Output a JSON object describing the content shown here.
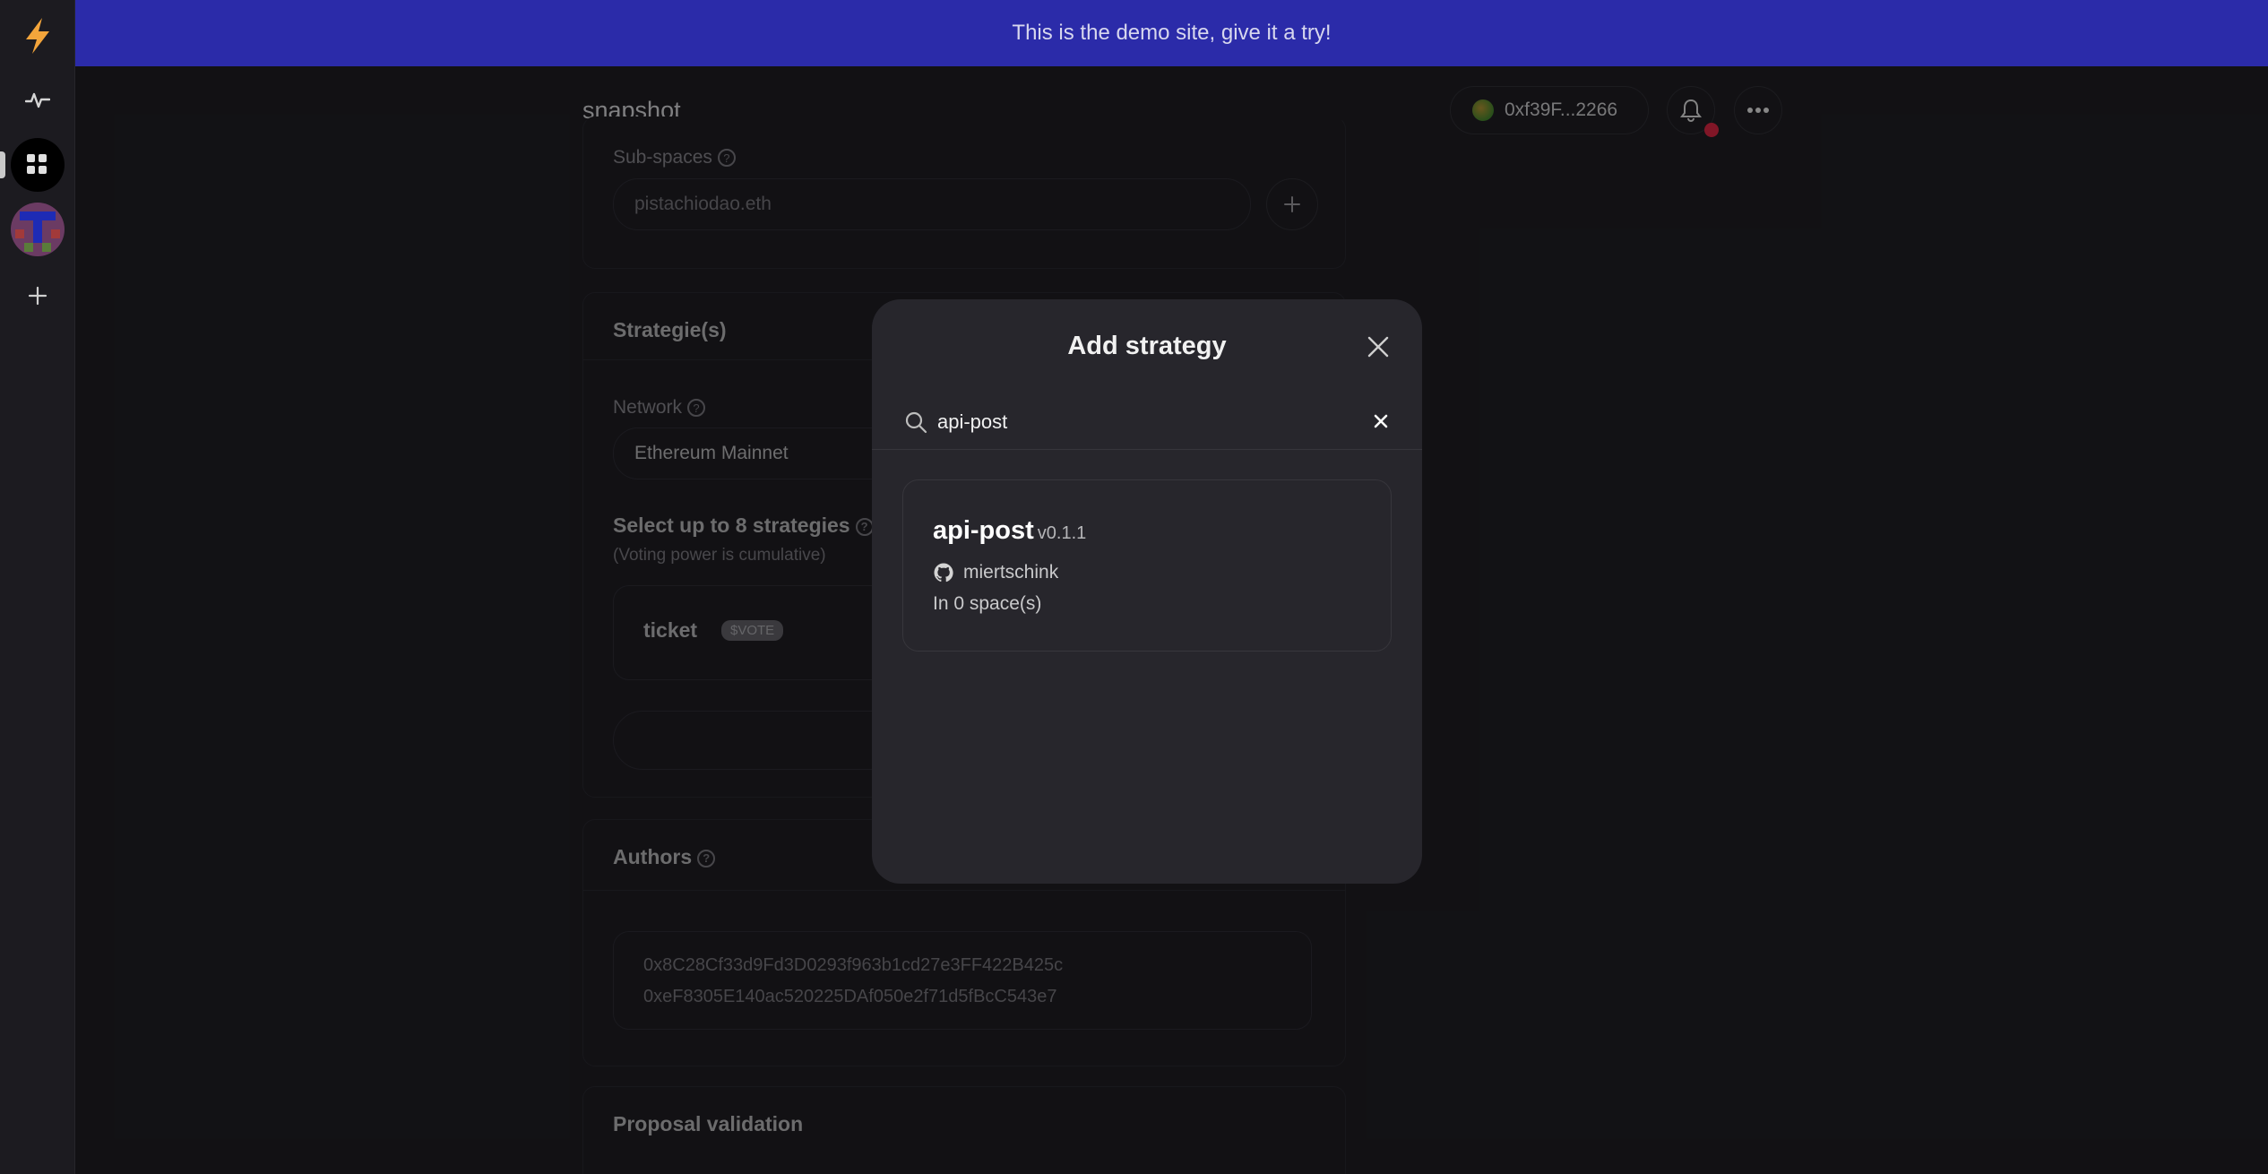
{
  "banner": {
    "text": "This is the demo site, give it a try!"
  },
  "header": {
    "brand": "snapshot",
    "wallet_address": "0xf39F...2266"
  },
  "subspaces": {
    "label": "Sub-spaces",
    "placeholder": "pistachiodao.eth"
  },
  "strategies": {
    "heading": "Strategie(s)",
    "network_label": "Network",
    "network_value": "Ethereum Mainnet",
    "select_heading": "Select up to 8 strategies",
    "select_sub": "(Voting power is cumulative)",
    "items": [
      {
        "name": "ticket",
        "badge": "$VOTE"
      }
    ]
  },
  "authors": {
    "heading": "Authors",
    "addresses": [
      "0x8C28Cf33d9Fd3D0293f963b1cd27e3FF422B425c",
      "0xeF8305E140ac520225DAf050e2f71d5fBcC543e7"
    ]
  },
  "proposal_validation": {
    "heading": "Proposal validation"
  },
  "modal": {
    "title": "Add strategy",
    "search_value": "api-post",
    "results": [
      {
        "name": "api-post",
        "version": "v0.1.1",
        "author": "miertschink",
        "spaces": "In 0 space(s)"
      }
    ]
  },
  "colors": {
    "banner": "#2b2ba9",
    "background": "#1c1b20",
    "modal": "#27262c",
    "accent_logo": "#f3a53b",
    "notification": "#c6233d"
  }
}
